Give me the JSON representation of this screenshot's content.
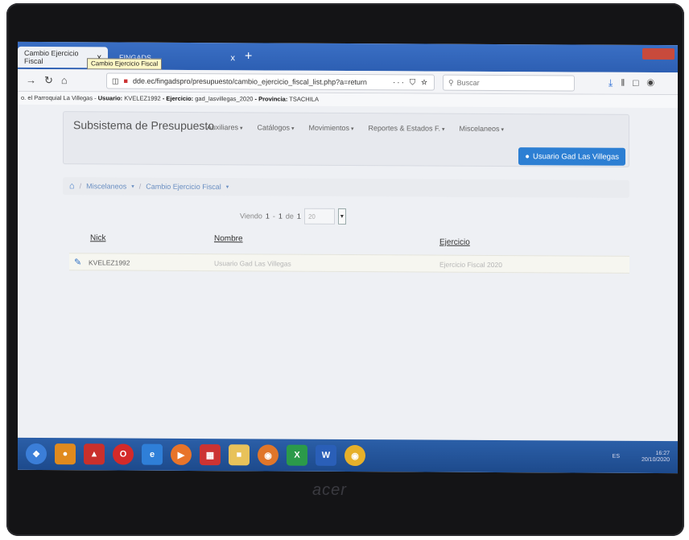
{
  "browser": {
    "tabs": [
      {
        "label": "Cambio Ejercicio Fiscal",
        "close": "x"
      },
      {
        "label": "FINGADS",
        "close": "x"
      }
    ],
    "new_tab": "+",
    "tooltip": "Cambio Ejercicio Fiscal",
    "url": "dde.ec/fingadspro/presupuesto/cambio_ejercicio_fiscal_list.php?a=return",
    "url_actions": "··· ⛉ ☆",
    "search_placeholder": "Buscar"
  },
  "context_line": {
    "prefix": "o. el Parroquial La Villegas - ",
    "usuario_label": "Usuario:",
    "usuario": "KVELEZ1992",
    "ejercicio_label": "- Ejercicio:",
    "ejercicio": "gad_lasvillegas_2020",
    "provincia_label": "- Provincia:",
    "provincia": "TSACHILA"
  },
  "navbar": {
    "brand": "Subsistema de Presupuesto",
    "menu": [
      "Auxiliares",
      "Catálogos",
      "Movimientos",
      "Reportes & Estados F.",
      "Miscelaneos"
    ],
    "user_button": "Usuario Gad Las Villegas"
  },
  "breadcrumb": {
    "items": [
      "Miscelaneos",
      "Cambio Ejercicio Fiscal"
    ]
  },
  "pagination": {
    "viendo": "Viendo",
    "from": "1",
    "dash": "-",
    "to": "1",
    "de": "de",
    "total": "1",
    "page_size": "20"
  },
  "table": {
    "headers": [
      "Nick",
      "Nombre",
      "Ejercicio"
    ],
    "rows": [
      {
        "nick": "KVELEZ1992",
        "nombre": "Usuario Gad Las Villegas",
        "ejercicio": "Ejercicio Fiscal 2020"
      }
    ]
  },
  "taskbar": {
    "lang": "ES",
    "time": "16:27",
    "date": "20/10/2020"
  },
  "device_logo": "acer",
  "colors": {
    "accent": "#2d7fd3",
    "taskbar": "#1d4a8c"
  }
}
